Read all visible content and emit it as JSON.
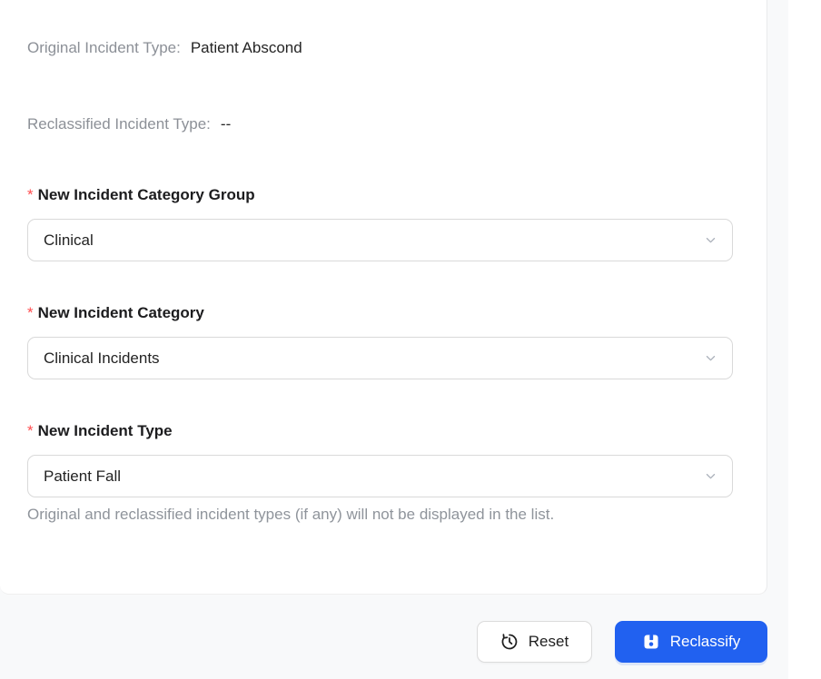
{
  "shared": {
    "required_mark": "*"
  },
  "info_rows": [
    {
      "label": "Original Incident Type:",
      "value": "Patient Abscond"
    },
    {
      "label": "Reclassified Incident Type:",
      "value": "--"
    }
  ],
  "form": {
    "fields": [
      {
        "label": "New Incident Category Group",
        "value": "Clinical"
      },
      {
        "label": "New Incident Category",
        "value": "Clinical Incidents"
      },
      {
        "label": "New Incident Type",
        "value": "Patient Fall"
      }
    ],
    "help_text": "Original and reclassified incident types (if any) will not be displayed in the list."
  },
  "footer": {
    "reset_label": "Reset",
    "reclassify_label": "Reclassify"
  },
  "icons": {
    "reset": "history-icon",
    "reclassify": "save-icon",
    "select": "chevron-down-icon"
  },
  "colors": {
    "primary": "#2161f0",
    "required": "#ff4d4f",
    "label_gray": "#8c9097",
    "text_dark": "#252525",
    "field_border": "#d9d9d9",
    "page_bg": "#f8f9fa"
  }
}
